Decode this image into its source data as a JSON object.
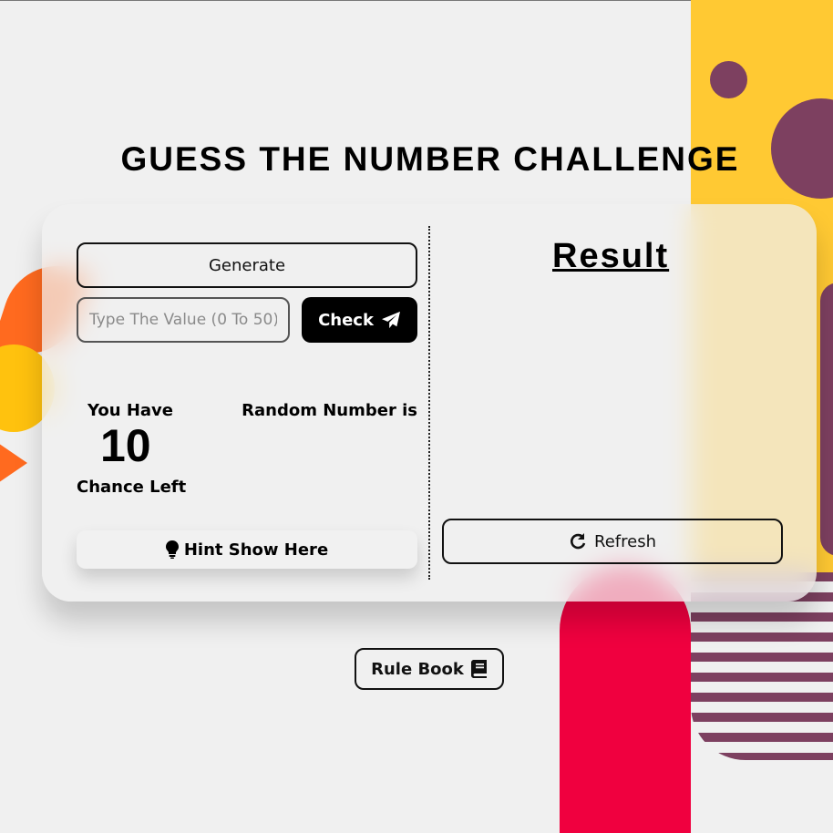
{
  "title": "GUESS THE NUMBER CHALLENGE",
  "game": {
    "generate_label": "Generate",
    "input_placeholder": "Type The Value (0 To 50)",
    "input_value": "",
    "check_label": "Check",
    "you_have_label": "You Have",
    "chances_count": "10",
    "chance_left_label": "Chance Left",
    "random_number_label": "Random Number is",
    "hint_label": "Hint Show Here"
  },
  "result": {
    "title": "Result",
    "refresh_label": "Refresh"
  },
  "rulebook_label": "Rule Book",
  "icons": {
    "check": "paper-plane-icon",
    "hint": "lightbulb-icon",
    "refresh": "refresh-icon",
    "rulebook": "book-icon"
  },
  "colors": {
    "yellow": "#ffc933",
    "red": "#f0003f",
    "purple": "#7d4060",
    "orange": "#ff6a1f",
    "button_dark": "#000000"
  }
}
